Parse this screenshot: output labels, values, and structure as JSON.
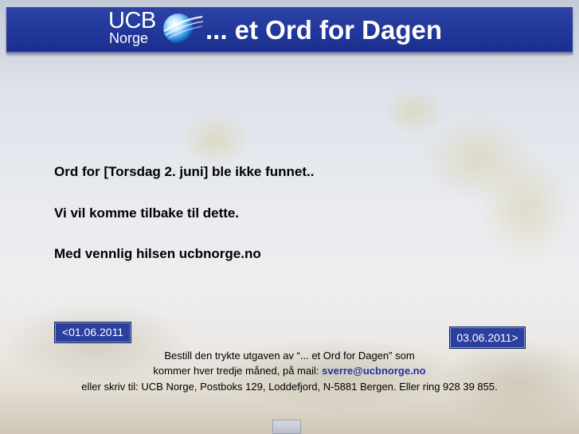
{
  "header": {
    "logo_line1": "UCB",
    "logo_line2": "Norge",
    "title": "... et Ord for Dagen",
    "bar_color": "#22379a"
  },
  "message": {
    "line1": "Ord for [Torsdag 2. juni] ble ikke funnet..",
    "line2": "Vi vil komme tilbake til dette.",
    "line3": "Med vennlig hilsen ucbnorge.no"
  },
  "nav": {
    "prev_label": "<01.06.2011",
    "next_label": "03.06.2011>",
    "button_color": "#2a3f9e"
  },
  "footer": {
    "line1": "Bestill den trykte utgaven av “... et Ord for Dagen” som",
    "line2_prefix": "kommer hver tredje måned, på mail: ",
    "email": "sverre@ucbnorge.no",
    "line3": "eller skriv til: UCB Norge, Postboks 129, Loddefjord, N-5881 Bergen. Eller ring 928 39 855.",
    "link_color": "#22349a"
  },
  "icons": {
    "logo_globe": "globe-icon",
    "bottom": "image-icon"
  }
}
